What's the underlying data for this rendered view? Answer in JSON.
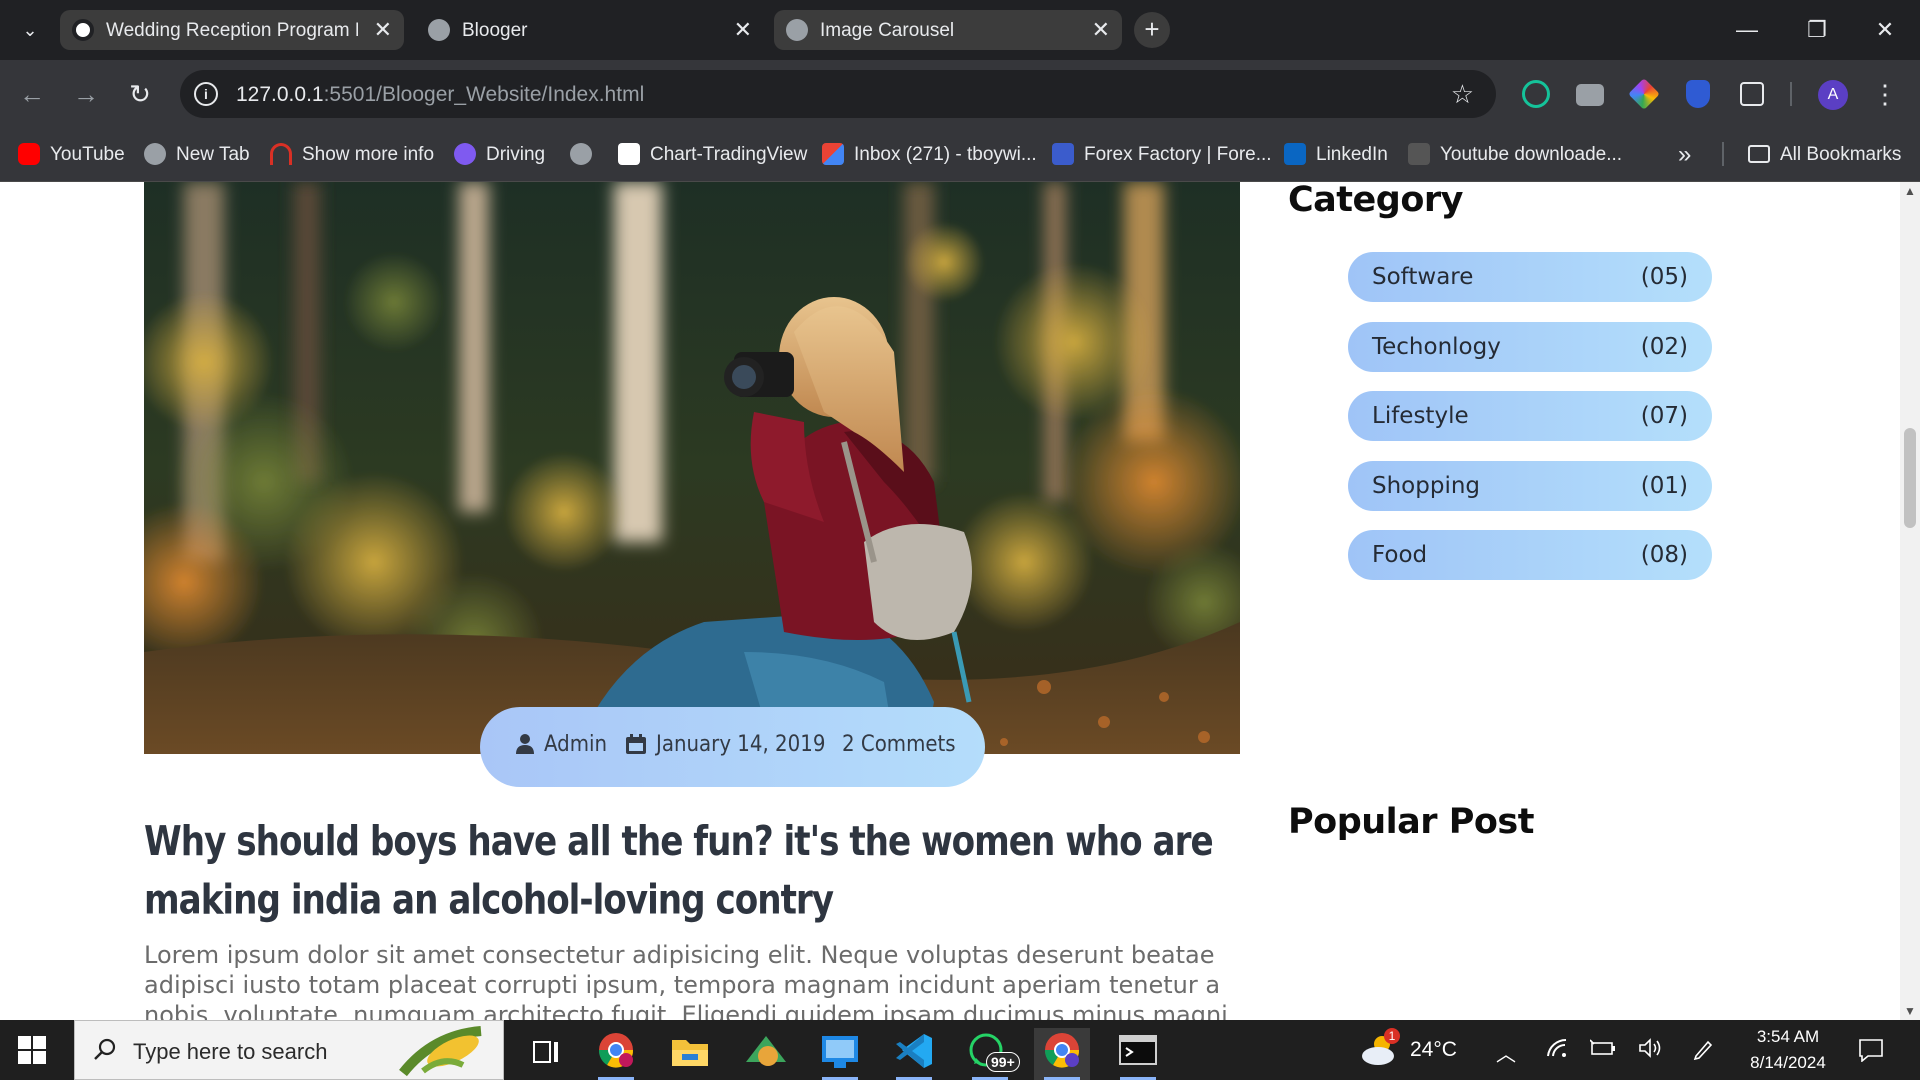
{
  "browser": {
    "tabs": [
      {
        "title": "Wedding Reception Program D",
        "active": true
      },
      {
        "title": "Blooger",
        "active": false
      },
      {
        "title": "Image Carousel",
        "active": false
      }
    ],
    "tab_close_glyph": "✕",
    "new_tab_glyph": "+",
    "url_host": "127.0.0.1",
    "url_rest": ":5501/Blooger_Website/Index.html",
    "bookmarks": [
      {
        "label": "YouTube",
        "icon": "youtube-icon",
        "color": "#ff0000"
      },
      {
        "label": "New Tab",
        "icon": "globe-icon",
        "color": "#9aa0a6"
      },
      {
        "label": "Show more info",
        "icon": "gauge-icon",
        "color": "#d93025"
      },
      {
        "label": "Driving",
        "icon": "twitch-icon",
        "color": "#7f5af0"
      },
      {
        "label": "",
        "icon": "globe-icon",
        "color": "#9aa0a6"
      },
      {
        "label": "Chart-TradingView",
        "icon": "tradingview-icon",
        "color": "#ffffff"
      },
      {
        "label": "Inbox (271) - tboywi...",
        "icon": "gmail-icon",
        "color": "#ea4335"
      },
      {
        "label": "Forex Factory | Fore...",
        "icon": "forexfactory-icon",
        "color": "#3b5ccc"
      },
      {
        "label": "LinkedIn",
        "icon": "linkedin-icon",
        "color": "#0a66c2"
      },
      {
        "label": "Youtube downloade...",
        "icon": "downloader-icon",
        "color": "#444444"
      }
    ],
    "more_bookmarks_glyph": "»",
    "all_bookmarks": "All Bookmarks",
    "profile_initial": "A"
  },
  "post": {
    "author": "Admin",
    "date": "January 14, 2019",
    "comments": "2 Commets",
    "title": "Why should boys have all the fun? it's the women who are making india an alcohol-loving contry",
    "body": "Lorem ipsum dolor sit amet consectetur adipisicing elit. Neque voluptas deserunt beatae adipisci iusto totam placeat corrupti ipsum, tempora magnam incidunt aperiam tenetur a nobis, voluptate, numquam architecto fugit. Eligendi quidem ipsam ducimus minus magni"
  },
  "sidebar": {
    "category_heading": "Category",
    "categories": [
      {
        "name": "Software",
        "count": "(05)"
      },
      {
        "name": "Techonlogy",
        "count": "(02)"
      },
      {
        "name": "Lifestyle",
        "count": "(07)"
      },
      {
        "name": "Shopping",
        "count": "(01)"
      },
      {
        "name": "Food",
        "count": "(08)"
      }
    ],
    "popular_heading": "Popular Post"
  },
  "taskbar": {
    "search_placeholder": "Type here to search",
    "whatsapp_badge": "99+",
    "weather_badge": "1",
    "temperature": "24°C",
    "time": "3:54 AM",
    "date": "8/14/2024"
  },
  "colors": {
    "pill_start": "#9fc4f7",
    "pill_end": "#b4dffb",
    "title_text": "#2e3540",
    "body_text": "#6b6b6b"
  }
}
